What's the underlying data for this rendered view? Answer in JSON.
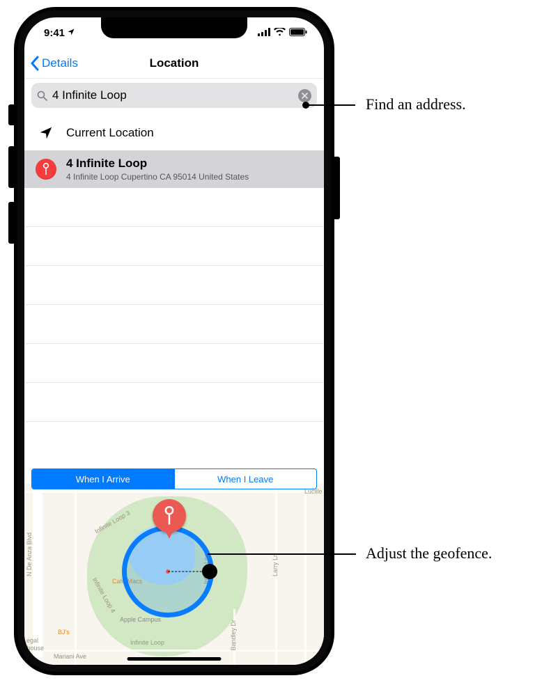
{
  "status": {
    "time": "9:41"
  },
  "nav": {
    "back_label": "Details",
    "title": "Location"
  },
  "search": {
    "value": "4 Infinite Loop"
  },
  "rows": {
    "current_location": "Current Location",
    "result": {
      "title": "4 Infinite Loop",
      "subtitle": "4 Infinite Loop Cupertino CA 95014 United States"
    }
  },
  "segments": {
    "arrive": "When I Arrive",
    "leave": "When I Leave"
  },
  "map_labels": {
    "deanza": "N De Anza Blvd",
    "cafemacs": "Cafe Macs",
    "applecampus": "Apple Campus",
    "bjs": "BJ's",
    "legal": "Legal",
    "ewhouse": "ewhouse",
    "lucille": "Lucille",
    "loop3": "Infinite Loop 3",
    "loop4": "Infinite Loop 4",
    "infloop": "Infinite Loop",
    "infloop2": "Infinite Loop",
    "mariani": "Mariani Ave",
    "bandley": "Bandley Dr",
    "larry": "Larry Ln"
  },
  "callouts": {
    "find": "Find an address.",
    "geofence": "Adjust the geofence."
  }
}
